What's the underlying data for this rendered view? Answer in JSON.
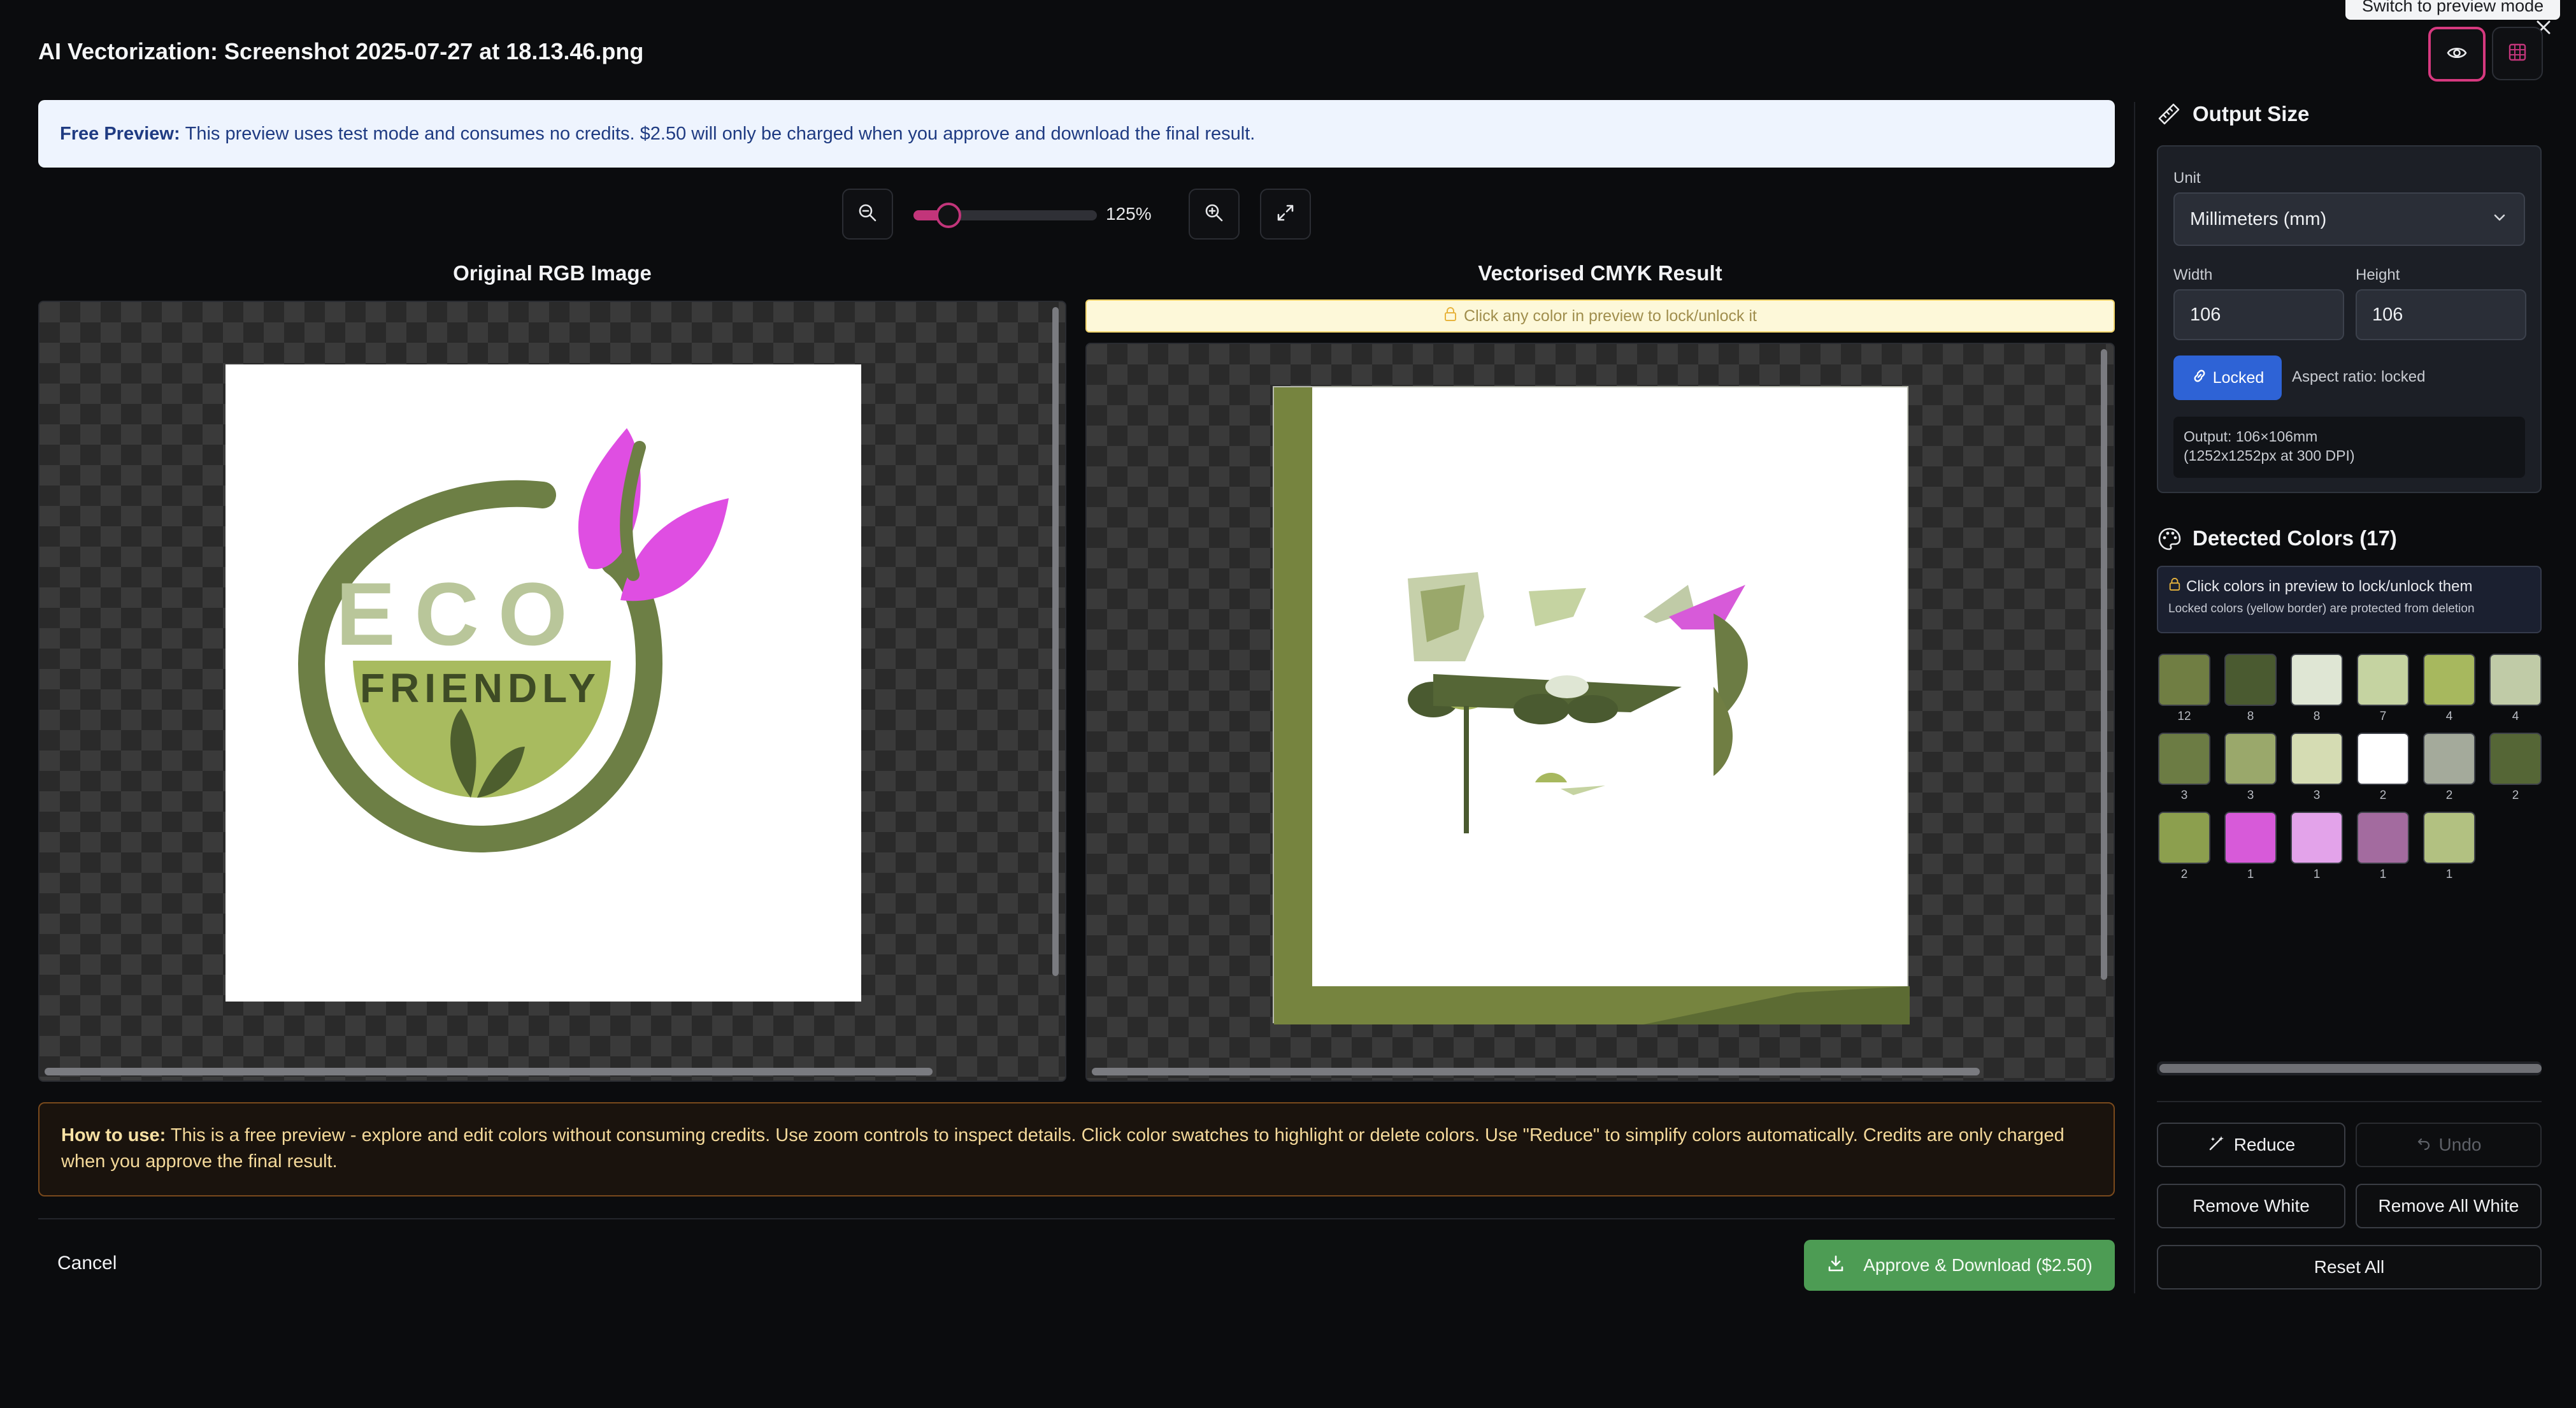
{
  "header": {
    "title": "AI Vectorization: Screenshot 2025-07-27 at 18.13.46.png",
    "tooltip": "Switch to preview mode",
    "icons": [
      "eye-icon",
      "grid-icon",
      "close-icon"
    ]
  },
  "banner": {
    "bold": "Free Preview:",
    "text": "This preview uses test mode and consumes no credits. $2.50 will only be charged when you approve and download the final result."
  },
  "zoom": {
    "value": "125%",
    "level_fraction": 0.19
  },
  "panels": {
    "left_title": "Original RGB Image",
    "right_title": "Vectorised CMYK Result",
    "lock_hint": "Click any color in preview to lock/unlock it"
  },
  "logo": {
    "line1": "ECO",
    "line2": "FRIENDLY"
  },
  "howto": {
    "bold": "How to use:",
    "text": "This is a free preview - explore and edit colors without consuming credits. Use zoom controls to inspect details. Click color swatches to highlight or delete colors. Use \"Reduce\" to simplify colors automatically. Credits are only charged when you approve the final result."
  },
  "footer": {
    "cancel": "Cancel",
    "approve": "Approve & Download ($2.50)"
  },
  "output_size": {
    "heading": "Output Size",
    "unit_label": "Unit",
    "unit_value": "Millimeters (mm)",
    "width_label": "Width",
    "height_label": "Height",
    "width": "106",
    "height": "106",
    "locked_label": "Locked",
    "aspect_text": "Aspect ratio: locked",
    "output_line1": "Output: 106×106mm",
    "output_line2": "(1252x1252px at 300 DPI)"
  },
  "colors": {
    "heading": "Detected Colors (17)",
    "hint1": "Click colors in preview to lock/unlock them",
    "hint2": "Locked colors (yellow border) are protected from deletion",
    "swatches": [
      {
        "color": "#707e43",
        "count": "12"
      },
      {
        "color": "#4a5a30",
        "count": "8"
      },
      {
        "color": "#dfe6d4",
        "count": "8"
      },
      {
        "color": "#c5d3a1",
        "count": "7"
      },
      {
        "color": "#a7b85e",
        "count": "4"
      },
      {
        "color": "#c0cba7",
        "count": "4"
      },
      {
        "color": "#6c7c44",
        "count": "3"
      },
      {
        "color": "#9aa86b",
        "count": "3"
      },
      {
        "color": "#d5dcb3",
        "count": "3"
      },
      {
        "color": "#ffffff",
        "count": "2"
      },
      {
        "color": "#a4aa9b",
        "count": "2"
      },
      {
        "color": "#556636",
        "count": "2"
      },
      {
        "color": "#8c9f4e",
        "count": "2"
      },
      {
        "color": "#d75ad9",
        "count": "1"
      },
      {
        "color": "#e3a3ea",
        "count": "1"
      },
      {
        "color": "#a36b9f",
        "count": "1"
      },
      {
        "color": "#b2c181",
        "count": "1"
      }
    ]
  },
  "actions": {
    "reduce": "Reduce",
    "undo": "Undo",
    "remove_white": "Remove White",
    "remove_all_white": "Remove All White",
    "reset_all": "Reset All"
  }
}
